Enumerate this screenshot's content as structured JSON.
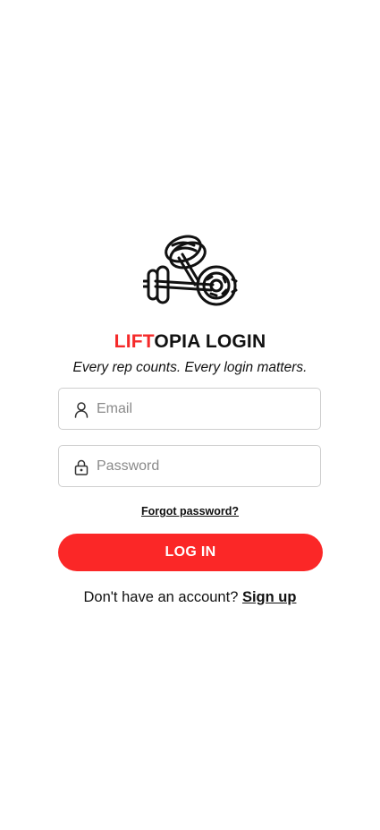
{
  "app": {
    "title_accent": "LIFT",
    "title_rest": "OPIA LOGIN",
    "tagline": "Every rep counts. Every login matters.",
    "logo_icon": "dumbbells-icon",
    "accent_color": "#f52a2a"
  },
  "form": {
    "email": {
      "placeholder": "Email",
      "value": "",
      "icon": "user-icon"
    },
    "password": {
      "placeholder": "Password",
      "value": "",
      "icon": "lock-icon"
    },
    "forgot_label": "Forgot password?",
    "login_label": "LOG IN",
    "login_color": "#fb2727"
  },
  "footer": {
    "prompt": "Don't have an account?",
    "signup_label": "Sign up"
  }
}
